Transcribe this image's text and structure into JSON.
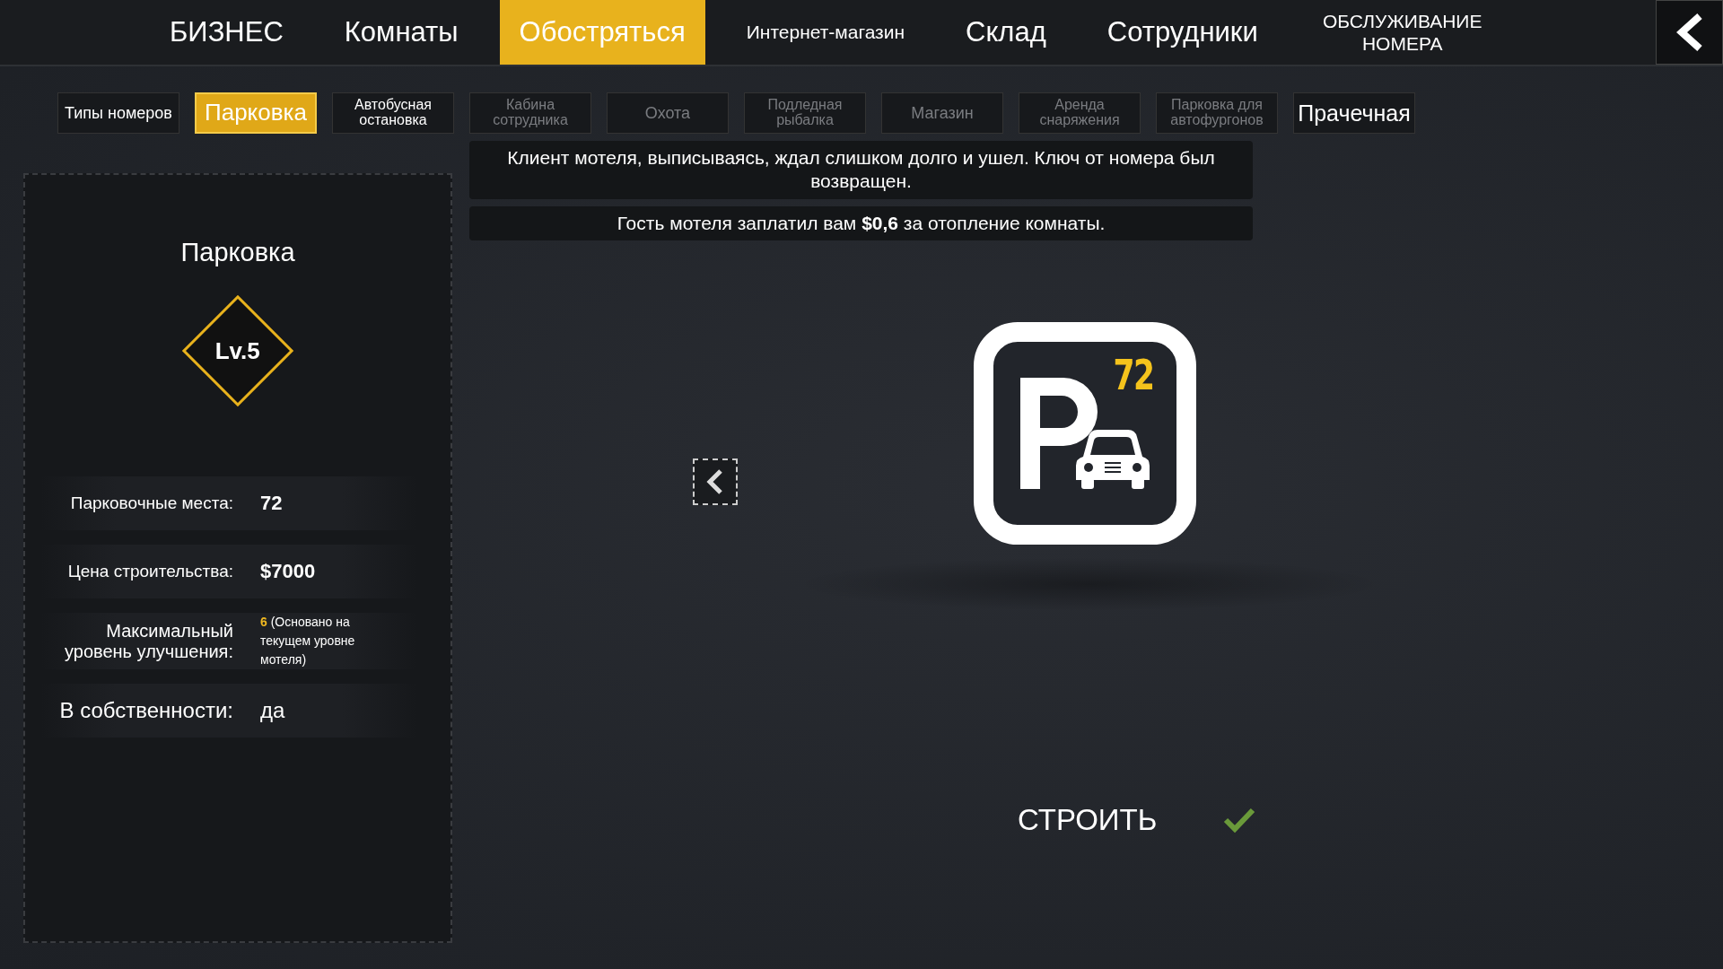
{
  "top_tabs": [
    {
      "label": "БИЗНЕС",
      "selected": false,
      "kind": "large"
    },
    {
      "label": "Комнаты",
      "selected": false,
      "kind": "large"
    },
    {
      "label": "Обостряться",
      "selected": true,
      "kind": "large"
    },
    {
      "label": "Интернет-магазин",
      "selected": false,
      "kind": "small"
    },
    {
      "label": "Склад",
      "selected": false,
      "kind": "large"
    },
    {
      "label": "Сотрудники",
      "selected": false,
      "kind": "large"
    },
    {
      "label": "ОБСЛУЖИВАНИЕ НОМЕРА",
      "selected": false,
      "kind": "small"
    }
  ],
  "sub_tabs": [
    {
      "label": "Типы номеров",
      "selected": false,
      "dim": false
    },
    {
      "label": "Парковка",
      "selected": true,
      "dim": false
    },
    {
      "label": "Автобусная остановка",
      "selected": false,
      "dim": false
    },
    {
      "label": "Кабина сотрудника",
      "selected": false,
      "dim": true
    },
    {
      "label": "Охота",
      "selected": false,
      "dim": true
    },
    {
      "label": "Подледная рыбалка",
      "selected": false,
      "dim": true
    },
    {
      "label": "Магазин",
      "selected": false,
      "dim": true
    },
    {
      "label": "Аренда снаряжения",
      "selected": false,
      "dim": true
    },
    {
      "label": "Парковка для автофургонов",
      "selected": false,
      "dim": true
    },
    {
      "label": "Прачечная",
      "selected": false,
      "dim": false
    }
  ],
  "notifications": [
    "Клиент мотеля, выписываясь, ждал слишком долго и ушел. Ключ от номера был возвращен.",
    "Гость мотеля заплатил вам **$0,6** за отопление комнаты."
  ],
  "panel": {
    "title": "Парковка",
    "level": "Lv.5",
    "stats": [
      {
        "kind": "plain",
        "label": "Парковочные места:",
        "value": "72"
      },
      {
        "kind": "plain",
        "label": "Цена строительства:",
        "value": "$7000"
      },
      {
        "kind": "note",
        "label": "Максимальный уровень улучшения:",
        "highlight": "6",
        "value": "(Основано на текущем уровне мотеля)"
      },
      {
        "kind": "large",
        "label": "В собственности:",
        "value": "да"
      }
    ]
  },
  "preview": {
    "badge": "72"
  },
  "build": {
    "label": "СТРОИТЬ"
  }
}
